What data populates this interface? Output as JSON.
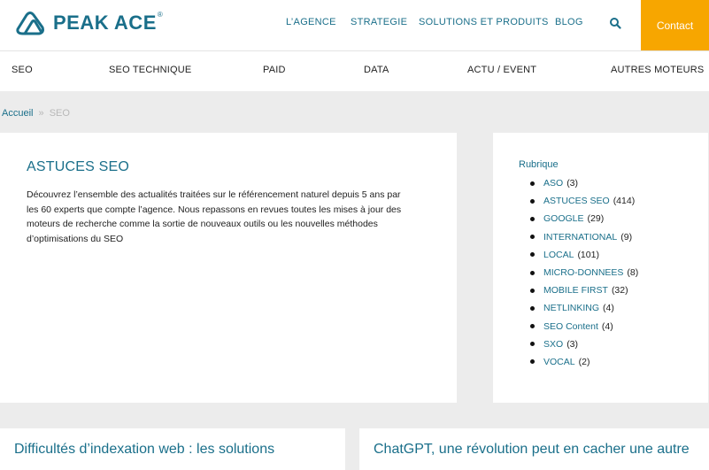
{
  "header": {
    "logo_text": "PEAK ACE",
    "logo_reg": "®",
    "nav": [
      "L’AGENCE",
      "STRATEGIE",
      "SOLUTIONS ET PRODUITS",
      "BLOG"
    ],
    "contact_label": "Contact",
    "accent_color": "#1a6f8a",
    "contact_color": "#f7a600"
  },
  "categories": [
    "SEO",
    "SEO TECHNIQUE",
    "PAID",
    "DATA",
    "ACTU / EVENT",
    "AUTRES MOTEURS"
  ],
  "breadcrumb": {
    "home": "Accueil",
    "separator": "»",
    "current": "SEO"
  },
  "intro": {
    "title": "ASTUCES SEO",
    "text_lines": [
      "Découvrez l’ensemble des actualités traitées sur le référencement naturel depuis 5 ans par",
      "les 60 experts que compte l’agence. Nous repassons en revues toutes les mises à jour des",
      "moteurs de recherche comme la sortie de nouveaux outils ou les nouvelles méthodes",
      "d’optimisations du SEO"
    ]
  },
  "rubrique": {
    "title": "Rubrique",
    "items": [
      {
        "label": "ASO",
        "count": "(3)"
      },
      {
        "label": "ASTUCES SEO",
        "count": "(414)"
      },
      {
        "label": "GOOGLE",
        "count": "(29)"
      },
      {
        "label": "INTERNATIONAL",
        "count": "(9)"
      },
      {
        "label": "LOCAL",
        "count": "(101)"
      },
      {
        "label": "MICRO-DONNEES",
        "count": "(8)"
      },
      {
        "label": "MOBILE FIRST",
        "count": "(32)"
      },
      {
        "label": "NETLINKING",
        "count": "(4)"
      },
      {
        "label": "SEO Content",
        "count": "(4)"
      },
      {
        "label": "SXO",
        "count": "(3)"
      },
      {
        "label": "VOCAL",
        "count": "(2)"
      }
    ]
  },
  "posts": [
    {
      "title": "Difficultés d’indexation web : les solutions"
    },
    {
      "title": "ChatGPT, une révolution peut en cacher une autre"
    }
  ]
}
